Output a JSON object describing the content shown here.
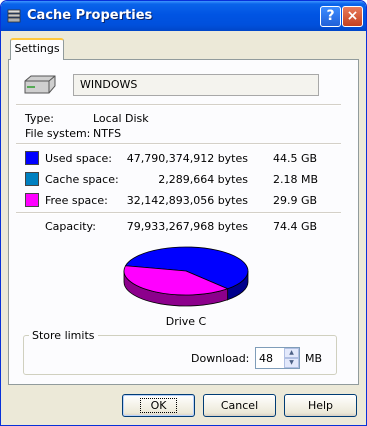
{
  "window": {
    "title": "Cache Properties",
    "help_label": "?",
    "close_label": "×"
  },
  "tabs": [
    {
      "label": "Settings",
      "active": true
    }
  ],
  "drive": {
    "name": "WINDOWS"
  },
  "info": {
    "type_label": "Type:",
    "type_value": "Local Disk",
    "fs_label": "File system:",
    "fs_value": "NTFS"
  },
  "space": [
    {
      "label": "Used space:",
      "bytes": "47,790,374,912 bytes",
      "size": "44.5 GB",
      "color": "#0000ff"
    },
    {
      "label": "Cache space:",
      "bytes": "2,289,664 bytes",
      "size": "2.18 MB",
      "color": "#0080c0"
    },
    {
      "label": "Free space:",
      "bytes": "32,142,893,056 bytes",
      "size": "29.9 GB",
      "color": "#ff00ff"
    }
  ],
  "capacity": {
    "label": "Capacity:",
    "bytes": "79,933,267,968 bytes",
    "size": "74.4 GB"
  },
  "chart_data": {
    "type": "pie",
    "title": "Drive C",
    "slices": [
      {
        "name": "Used space",
        "value": 47790374912,
        "color": "#0000ff"
      },
      {
        "name": "Cache space",
        "value": 2289664,
        "color": "#0080c0"
      },
      {
        "name": "Free space",
        "value": 32142893056,
        "color": "#ff00ff"
      }
    ]
  },
  "store_limits": {
    "legend": "Store limits",
    "download_label": "Download:",
    "download_value": "48",
    "unit": "MB"
  },
  "buttons": {
    "ok": "OK",
    "cancel": "Cancel",
    "help": "Help"
  }
}
